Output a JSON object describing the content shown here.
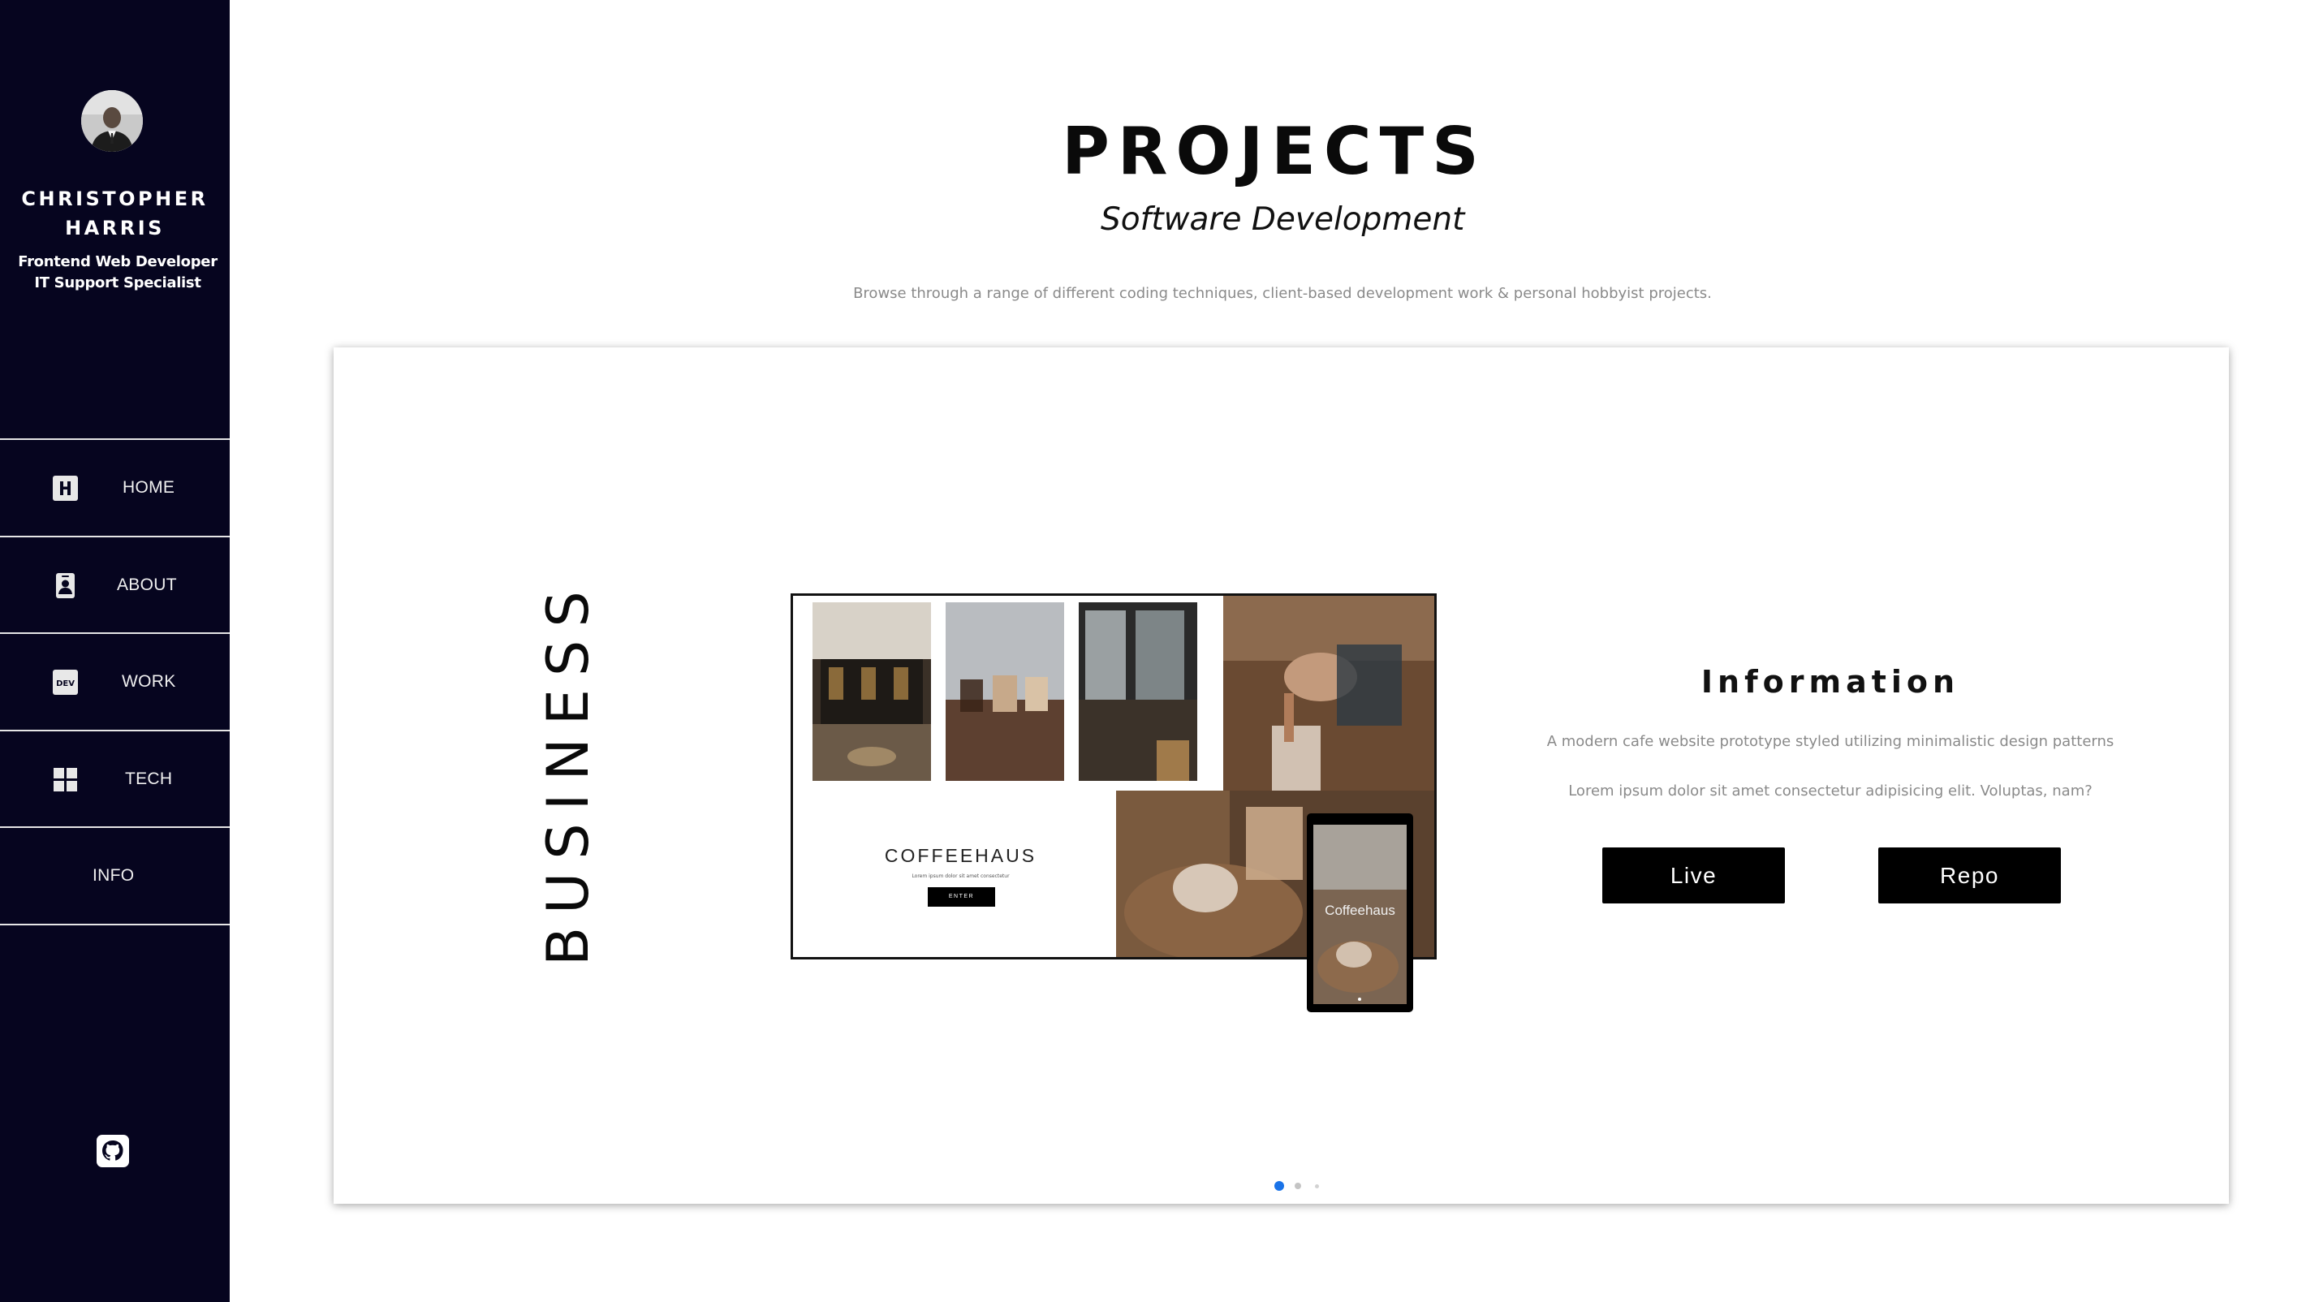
{
  "profile": {
    "name_line1": "CHRISTOPHER",
    "name_line2": "HARRIS",
    "role_line1": "Frontend Web Developer",
    "role_line2": "IT Support Specialist"
  },
  "sidebar": {
    "items": [
      {
        "label": "HOME",
        "icon": "h-square-icon"
      },
      {
        "label": "ABOUT",
        "icon": "id-badge-icon"
      },
      {
        "label": "WORK",
        "icon": "dev-icon"
      },
      {
        "label": "TECH",
        "icon": "windows-icon"
      },
      {
        "label": "INFO",
        "icon": ""
      }
    ],
    "footer_icon": "github-icon"
  },
  "header": {
    "title": "PROJECTS",
    "subtitle": "Software Development",
    "description": "Browse through a range of different coding techniques, client-based development work & personal hobbyist projects."
  },
  "project": {
    "category": "BUSINESS",
    "preview": {
      "title": "COFFEEHAUS",
      "tagline": "Lorem ipsum dolor sit amet consectetur",
      "enter_label": "ENTER",
      "phone_label": "Coffeehaus"
    },
    "info": {
      "title": "Information",
      "text1": "A modern cafe website prototype styled utilizing minimalistic design patterns",
      "text2": "Lorem ipsum dolor sit amet consectetur adipisicing elit. Voluptas, nam?",
      "live_label": "Live",
      "repo_label": "Repo"
    }
  },
  "carousel": {
    "count": 3,
    "active_index": 0,
    "active_color": "#1a73e8"
  },
  "colors": {
    "sidebar_bg": "#06051f",
    "button_bg": "#000000"
  }
}
